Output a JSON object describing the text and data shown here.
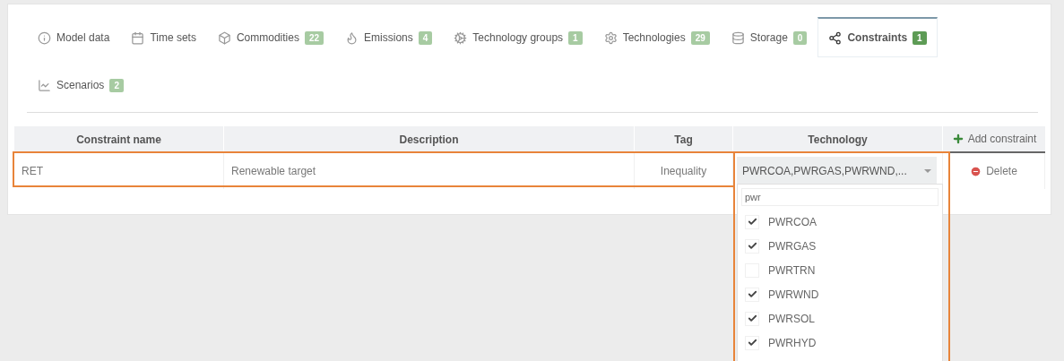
{
  "tabs": [
    {
      "label": "Model data",
      "selected": false
    },
    {
      "label": "Time sets",
      "selected": false
    },
    {
      "label": "Commodities",
      "badge": "22",
      "selected": false
    },
    {
      "label": "Emissions",
      "badge": "4",
      "selected": false
    },
    {
      "label": "Technology groups",
      "badge": "1",
      "selected": false
    },
    {
      "label": "Technologies",
      "badge": "29",
      "selected": false
    },
    {
      "label": "Storage",
      "badge": "0",
      "selected": false
    },
    {
      "label": "Constraints",
      "badge": "1",
      "selected": true
    },
    {
      "label": "Scenarios",
      "badge": "2",
      "selected": false
    }
  ],
  "table": {
    "columns": [
      "Constraint name",
      "Description",
      "Tag",
      "Technology"
    ],
    "add_button": "Add constraint",
    "rows": [
      {
        "name": "RET",
        "description": "Renewable target",
        "tag": "Inequality",
        "technology": "PWRCOA,PWRGAS,PWRWND,...",
        "delete": "Delete"
      }
    ]
  },
  "dropdown": {
    "search": "pwr",
    "options": [
      {
        "label": "PWRCOA",
        "checked": true
      },
      {
        "label": "PWRGAS",
        "checked": true
      },
      {
        "label": "PWRTRN",
        "checked": false
      },
      {
        "label": "PWRWND",
        "checked": true
      },
      {
        "label": "PWRSOL",
        "checked": true
      },
      {
        "label": "PWRHYD",
        "checked": true
      }
    ]
  }
}
